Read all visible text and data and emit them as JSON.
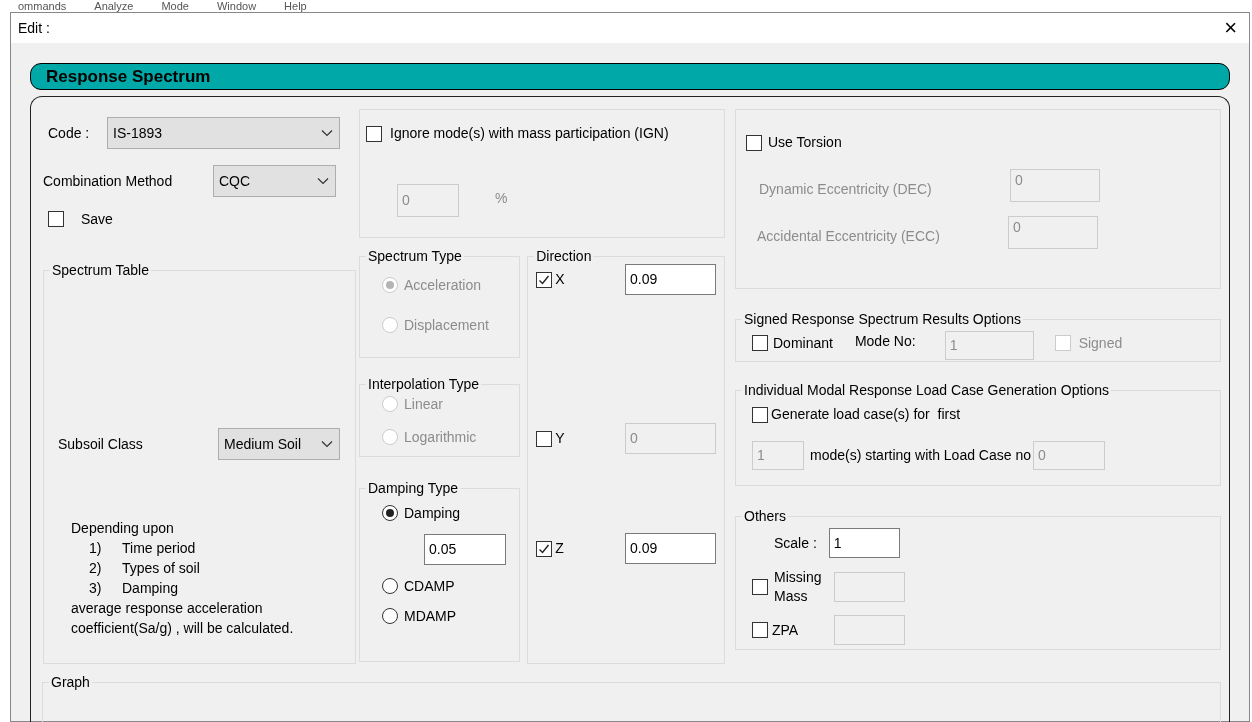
{
  "background_menu": [
    "ommands",
    "Analyze",
    "Mode",
    "Window",
    "Help"
  ],
  "window": {
    "title": "Edit :",
    "close": "×"
  },
  "header": "Response Spectrum",
  "code": {
    "label": "Code :",
    "value": "IS-1893"
  },
  "combination_method": {
    "label": "Combination Method",
    "value": "CQC"
  },
  "save": {
    "label": "Save",
    "checked": false
  },
  "spectrum_table": {
    "title": "Spectrum Table",
    "subsoil_label": "Subsoil Class",
    "subsoil_value": "Medium Soil",
    "note_intro": "Depending upon",
    "note_items": [
      {
        "number": "1)",
        "text": "Time period"
      },
      {
        "number": "2)",
        "text": "Types of soil"
      },
      {
        "number": "3)",
        "text": "Damping"
      }
    ],
    "note_lines": [
      "average response acceleration",
      "coefficient(Sa/g) , will be calculated."
    ]
  },
  "ignore_modes": {
    "label": "Ignore mode(s) with mass participation (IGN)",
    "checked": false,
    "value": "0",
    "unit": "%"
  },
  "spectrum_type": {
    "title": "Spectrum Type",
    "disabled": true,
    "options": [
      {
        "label": "Acceleration",
        "selected": true
      },
      {
        "label": "Displacement",
        "selected": false
      }
    ]
  },
  "interpolation_type": {
    "title": "Interpolation Type",
    "disabled": true,
    "options": [
      {
        "label": "Linear",
        "selected": false
      },
      {
        "label": "Logarithmic",
        "selected": false
      }
    ]
  },
  "damping_type": {
    "title": "Damping Type",
    "disabled": false,
    "options": [
      {
        "label": "Damping",
        "selected": true,
        "value": "0.05"
      },
      {
        "label": "CDAMP",
        "selected": false
      },
      {
        "label": "MDAMP",
        "selected": false
      }
    ]
  },
  "direction": {
    "title": "Direction",
    "axes": [
      {
        "label": "X",
        "checked": true,
        "value": "0.09"
      },
      {
        "label": "Y",
        "checked": false,
        "value": "0"
      },
      {
        "label": "Z",
        "checked": true,
        "value": "0.09"
      }
    ]
  },
  "torsion": {
    "label": "Use Torsion",
    "checked": false,
    "fields": [
      {
        "label": "Dynamic Eccentricity (DEC)",
        "value": "0"
      },
      {
        "label": "Accidental Eccentricity (ECC)",
        "value": "0"
      }
    ]
  },
  "signed_results": {
    "title": "Signed Response Spectrum Results Options",
    "dominant": {
      "label": "Dominant",
      "checked": false
    },
    "mode_label": "Mode No:",
    "mode_value": "1",
    "signed": {
      "label": "Signed",
      "checked": false,
      "disabled": true
    }
  },
  "modal_load_cases": {
    "title": "Individual Modal Response Load Case Generation Options",
    "generate": {
      "label": "Generate load case(s) for  first",
      "checked": false
    },
    "modes_value": "1",
    "middle_label": "mode(s) starting with Load Case no",
    "start_value": "0"
  },
  "others": {
    "title": "Others",
    "scale_label": "Scale :",
    "scale_value": "1",
    "missing_mass": {
      "label": "Missing Mass",
      "checked": false
    },
    "zpa": {
      "label": "ZPA",
      "checked": false
    }
  },
  "graph": {
    "title": "Graph"
  }
}
